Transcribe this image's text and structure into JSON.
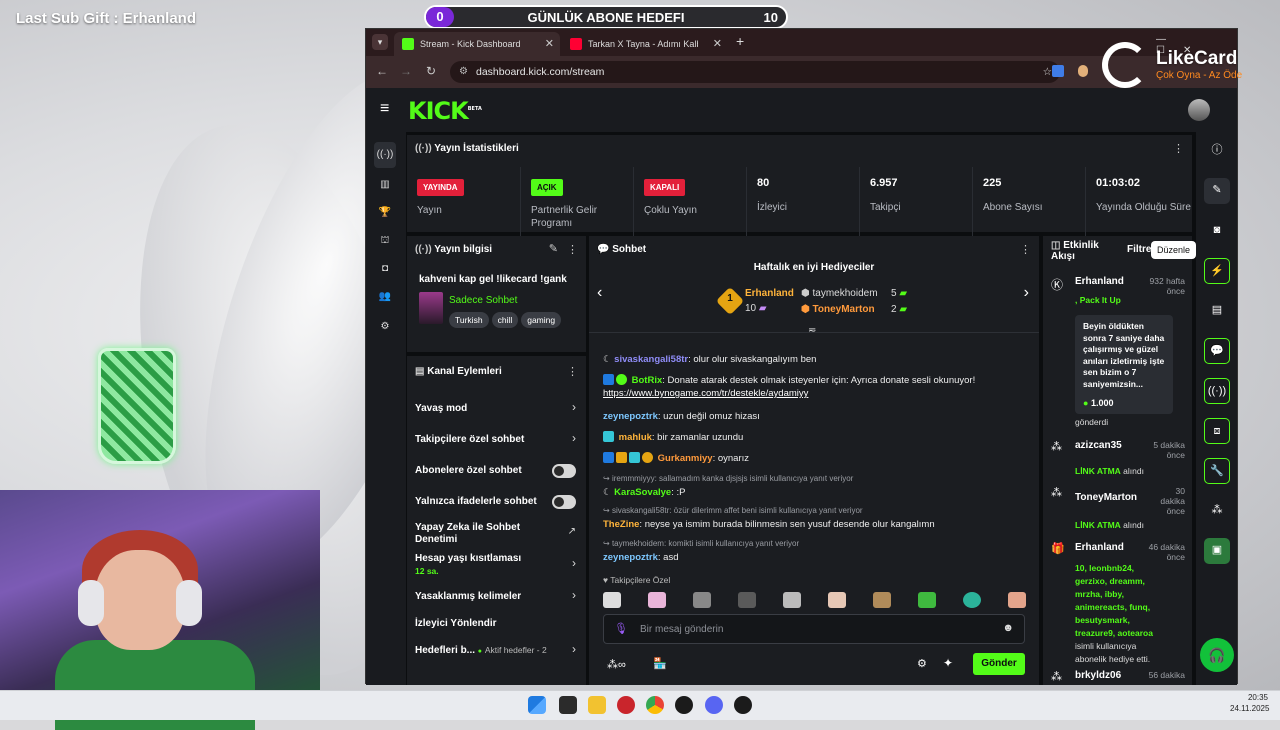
{
  "overlay": {
    "last_sub_gift": "Last Sub Gift : Erhanland",
    "goal_current": "0",
    "goal_title": "GÜNLÜK ABONE HEDEFI",
    "goal_target": "10"
  },
  "browser": {
    "tabs": [
      {
        "label": "Stream - Kick Dashboard"
      },
      {
        "label": "Tarkan X Tayna - Adımı Kalbine"
      }
    ],
    "url": "dashboard.kick.com/stream",
    "new_tab": "+"
  },
  "likecard": {
    "brand": "LikeCard",
    "slogan": "Çok Oyna - Az Öde"
  },
  "kick": {
    "logo": "KICK",
    "beta": "BETA",
    "tooltip": "Düzenle",
    "stats": {
      "title": "Yayın İstatistikleri",
      "items": [
        {
          "badge": "YAYINDA",
          "label": "Yayın"
        },
        {
          "badge": "AÇIK",
          "label": "Partnerlik Gelir Programı"
        },
        {
          "badge": "KAPALI",
          "label": "Çoklu Yayın"
        },
        {
          "value": "80",
          "label": "İzleyici"
        },
        {
          "value": "6.957",
          "label": "Takipçi"
        },
        {
          "value": "225",
          "label": "Abone Sayısı"
        },
        {
          "value": "01:03:02",
          "label": "Yayında Olduğu Süre"
        }
      ]
    },
    "stream_info": {
      "title": "Yayın bilgisi",
      "stream_title": "kahveni kap gel !likecard !gank",
      "category": "Sadece Sohbet",
      "tags": [
        "Turkish",
        "chill",
        "gaming"
      ]
    },
    "channel_actions": {
      "title": "Kanal Eylemleri",
      "items": [
        {
          "label": "Yavaş mod"
        },
        {
          "label": "Takipçilere özel sohbet"
        },
        {
          "label": "Abonelere özel sohbet"
        },
        {
          "label": "Yalnızca ifadelerle sohbet"
        },
        {
          "label": "Yapay Zeka ile Sohbet Denetimi"
        },
        {
          "label": "Hesap yaşı kısıtlaması",
          "sub": "12 sa."
        },
        {
          "label": "Yasaklanmış kelimeler"
        },
        {
          "label": "İzleyici Yönlendir"
        },
        {
          "label": "Hedefleri b...",
          "sub": "Aktif hedefler - 2"
        }
      ]
    },
    "chat": {
      "title": "Sohbet",
      "top_gifters_title": "Haftalık en iyi Hediyeciler",
      "top1": {
        "rank": "1",
        "name": "Erhanland",
        "count": "10"
      },
      "top2": {
        "name": "taymekhoidem",
        "count": "5"
      },
      "top3": {
        "name": "ToneyMarton",
        "count": "2"
      },
      "messages": [
        {
          "user": "sivaskangali58tr",
          "text": ": olur olur sivaskangalıyım ben"
        },
        {
          "user": "BotRix",
          "text": ": Donate atarak destek olmak isteyenler için: Ayrıca donate sesli okunuyor!",
          "link": "https://www.bynogame.com/tr/destekle/aydamiyy"
        },
        {
          "user": "zeynepoztrk",
          "text": ": uzun değil omuz hizası"
        },
        {
          "user": "mahluk",
          "text": ": bir zamanlar uzundu"
        },
        {
          "user": "Gurkanmiyy",
          "text": ": oynarız"
        },
        {
          "reply": "iremmmiyyy: sallamadım kanka djsjsjs isimli kullanıcıya yanıt veriyor",
          "user": "KaraSovalye",
          "text": ": :P"
        },
        {
          "reply": "sivaskangali58tr: özür dilerimm affet beni isimli kullanıcıya yanıt veriyor",
          "user": "TheZine",
          "text": ": neyse ya ismim burada bilinmesin sen yusuf desende olur kangalımn"
        },
        {
          "reply": "taymekhoidem: komikti isimli kullanıcıya yanıt veriyor",
          "user": "zeynepoztrk",
          "text": ": asd"
        }
      ],
      "followers_only": "Takipçilere Özel",
      "input_placeholder": "Bir mesaj gönderin",
      "send": "Gönder"
    },
    "activity": {
      "title": "Etkinlik Akışı",
      "filter": "Filtre",
      "items": [
        {
          "name": "Erhanland",
          "time": "932 hafta önce",
          "line": ", Pack It Up",
          "quote": "Beyin öldükten sonra 7 saniye daha çalışırmış ve güzel anıları izletirmiş işte sen bizim o 7 saniyemizsin...",
          "amount": "1.000",
          "after": "gönderdi"
        },
        {
          "name": "azizcan35",
          "time": "5 dakika önce",
          "green": "LİNK ATMA",
          "white": " alındı"
        },
        {
          "name": "ToneyMarton",
          "time": "30 dakika önce",
          "green": "LİNK ATMA",
          "white": " alındı"
        },
        {
          "name": "Erhanland",
          "time": "46 dakika önce",
          "green": "10, leonbnb24, gerzixo, dreamm, mrzha, ibby, animereacts, funq, besutysmark, treazure9, aotearoa",
          "white": "isimli kullanıcıya abonelik hediye etti."
        },
        {
          "name": "brkyldz06",
          "time": "56 dakika"
        }
      ]
    }
  },
  "taskbar": {
    "time": "20:35",
    "date": "24.11.2025"
  }
}
